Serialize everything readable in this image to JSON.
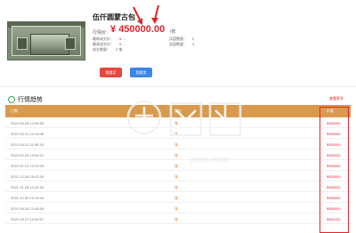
{
  "product": {
    "title": "伍仟圆蒙古包",
    "price_label": "行情价：",
    "price_value": "450000.00",
    "price_unit": "/张",
    "info_left": [
      {
        "label": "最新成交价：",
        "value": "¥ - -"
      },
      {
        "label": "最高成交价：",
        "value": "¥ - -"
      },
      {
        "label": "成交数量：",
        "value": "0 笔"
      }
    ],
    "info_right": [
      {
        "label": "买盘数量：",
        "value": "0"
      },
      {
        "label": "卖盘数量：",
        "value": "4"
      }
    ]
  },
  "buttons": {
    "buy": "我要买",
    "sell": "我要卖"
  },
  "section": {
    "title": "行情趋势",
    "more": "查看更多"
  },
  "table": {
    "headers": [
      "日期",
      "报价",
      "价格"
    ],
    "rows": [
      {
        "date": "2022-06-28 12:05:53",
        "mark": "张",
        "price": "¥450000"
      },
      {
        "date": "2022-05-31 14:13:46",
        "mark": "张",
        "price": "¥450000"
      },
      {
        "date": "2022-04-21 11:50:15",
        "mark": "张",
        "price": "¥450000"
      },
      {
        "date": "2022-02-26 13:04:21",
        "mark": "张",
        "price": "¥450000"
      },
      {
        "date": "2022-01-22 13:20:25",
        "mark": "张",
        "price": "¥500000"
      },
      {
        "date": "2021-12-28 15:42:26",
        "mark": "张",
        "price": "¥500000"
      },
      {
        "date": "2021-11-28 14:22:48",
        "mark": "张",
        "price": "¥560000"
      },
      {
        "date": "2021-10-30 13:16:44",
        "mark": "张",
        "price": "¥560000"
      },
      {
        "date": "2021-09-26 12:46:28",
        "mark": "张",
        "price": "¥560000"
      },
      {
        "date": "2021-08-27 12:50:07",
        "mark": "张",
        "price": "¥561000"
      }
    ]
  },
  "watermark": {
    "text": "dlmb.com"
  },
  "colors": {
    "accent_red": "#e0242c",
    "header_orange": "#d99a4e",
    "buy_btn": "#e5483f",
    "sell_btn": "#3a87e8",
    "section_green": "#3aa655"
  }
}
